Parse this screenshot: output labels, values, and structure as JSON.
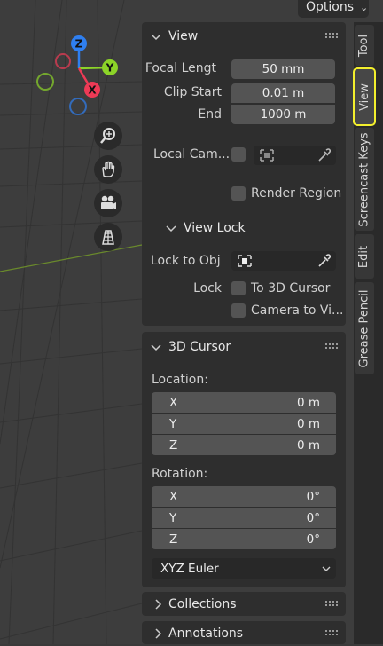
{
  "header": {
    "options_label": "Options"
  },
  "gizmo": {
    "z_label": "Z",
    "y_label": "Y",
    "x_label": "X"
  },
  "view_panel": {
    "title": "View",
    "focal_length_label": "Focal Lengt",
    "focal_length_value": "50 mm",
    "clip_start_label": "Clip Start",
    "clip_start_value": "0.01 m",
    "clip_end_label": "End",
    "clip_end_value": "1000 m",
    "local_camera_label": "Local Cam...",
    "render_region_label": "Render Region",
    "view_lock": {
      "title": "View Lock",
      "lock_to_obj_label": "Lock to Obj",
      "lock_label": "Lock",
      "to_3d_cursor_label": "To 3D Cursor",
      "camera_to_view_label": "Camera to Vi..."
    }
  },
  "cursor_panel": {
    "title": "3D Cursor",
    "location_label": "Location:",
    "location": [
      {
        "axis": "X",
        "value": "0 m"
      },
      {
        "axis": "Y",
        "value": "0 m"
      },
      {
        "axis": "Z",
        "value": "0 m"
      }
    ],
    "rotation_label": "Rotation:",
    "rotation": [
      {
        "axis": "X",
        "value": "0°"
      },
      {
        "axis": "Y",
        "value": "0°"
      },
      {
        "axis": "Z",
        "value": "0°"
      }
    ],
    "rotation_mode": "XYZ Euler"
  },
  "collapsed_panels": {
    "collections": "Collections",
    "annotations": "Annotations"
  },
  "tabs": [
    "Tool",
    "View",
    "Screencast Keys",
    "Edit",
    "Grease Pencil"
  ],
  "active_tab": "View",
  "colors": {
    "axis_x": "#ee3a56",
    "axis_y": "#8cd428",
    "axis_z": "#2f7ff0",
    "active_tab_outline": "#f3ef2d"
  },
  "icons": [
    "chevron-down-icon",
    "chevron-right-icon",
    "grip-icon",
    "zoom-icon",
    "hand-icon",
    "camera-icon",
    "grid-icon",
    "eyedropper-icon",
    "object-icon"
  ]
}
